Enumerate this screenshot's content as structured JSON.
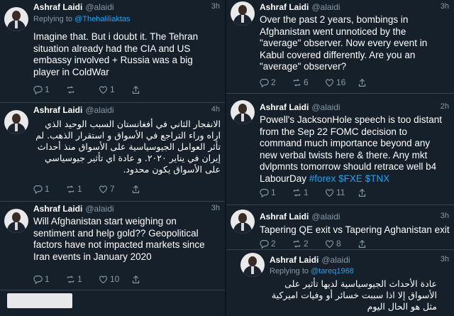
{
  "left": [
    {
      "name": "Ashraf Laidi",
      "handle": "@alaidi",
      "time": "3h",
      "reply_prefix": "Replying to ",
      "reply_to": "@Thehaliliaktas",
      "text": "Imagine that. But i doubt it. The Tehran situation already had the CIA and US embassy involved + Russia was a big player in ColdWar",
      "replies": "1",
      "retweets": "",
      "likes": "1"
    },
    {
      "name": "Ashraf Laidi",
      "handle": "@alaidi",
      "time": "4h",
      "text": "الانفجار الثاني في أفغانستان السبب الوحيد الذي اراه وراء التراجع في الأسواق و استقرار الذهب. لم تأثر العوامل الجيوسياسية على الأسواق منذ أحداث إيران في يناير ٢٠٢٠. و عادة اي تأثير جيوسياسي على الأسواق يكون محدود.",
      "replies": "1",
      "retweets": "1",
      "likes": "7"
    },
    {
      "name": "Ashraf Laidi",
      "handle": "@alaidi",
      "time": "3h",
      "text": "Will Afghanistan start weighing on sentiment and help gold?? Geopolitical factors have not impacted markets since Iran events in January 2020",
      "replies": "1",
      "retweets": "1",
      "likes": "10"
    }
  ],
  "right": [
    {
      "name": "Ashraf Laidi",
      "handle": "@alaidi",
      "time": "3h",
      "text": "Over the past 2 years, bombings in Afghanistan went unnoticed by the \"average\" observer. Now every event in Kabul covered differently. Are you an \"average\" observer?",
      "replies": "2",
      "retweets": "6",
      "likes": "16"
    },
    {
      "name": "Ashraf Laidi",
      "handle": "@alaidi",
      "time": "2h",
      "text_main": "Powell's JacksonHole speech is too distant from the Sep 22 FOMC decision to command much importance beyond any new verbal twists here & there. Any mkt dvlpmnts tomorrow should retrace well b4 LabourDay ",
      "hashtags": "#forex $FXE $TNX",
      "replies": "1",
      "retweets": "1",
      "likes": "11"
    },
    {
      "name": "Ashraf Laidi",
      "handle": "@alaidi",
      "time": "3h",
      "text": "Tapering QE exit vs Tapering Aghanistan exit",
      "replies": "2",
      "retweets": "2",
      "likes": "8"
    },
    {
      "name": "Ashraf Laidi",
      "handle": "@alaidi",
      "time": "3h",
      "reply_prefix": "Replying to ",
      "reply_to": "@tareq1968",
      "text": "عادة الأحداث الجيوسياسية لديها تأثير على الأسواق إلا اذا سببت خسائر أو وفيات اميركية مثل هو الحال اليوم"
    }
  ],
  "colors": {
    "background": "#15202b",
    "link": "#1da1f2",
    "muted": "#8899a6",
    "border": "#38444d"
  },
  "icons": [
    "avatar",
    "reply-icon",
    "retweet-icon",
    "like-icon",
    "share-icon"
  ]
}
